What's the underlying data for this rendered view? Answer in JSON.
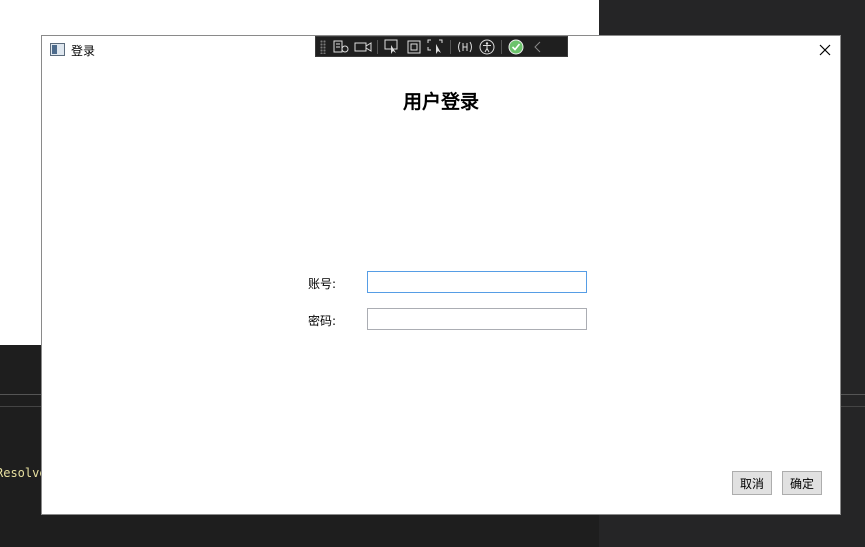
{
  "background": {
    "console_text": "Resolve"
  },
  "window": {
    "title": "登录",
    "heading": "用户登录",
    "fields": {
      "account": {
        "label": "账号:",
        "value": "",
        "placeholder": ""
      },
      "password": {
        "label": "密码:",
        "value": "",
        "placeholder": ""
      }
    },
    "buttons": {
      "cancel": "取消",
      "confirm": "确定"
    }
  },
  "debug_toolbar": {
    "icons": [
      "live-visual-tree-icon",
      "record-icon",
      "select-element-icon",
      "display-adorners-icon",
      "track-focus-icon",
      "binding-failures-icon",
      "accessibility-icon",
      "hot-reload-check-icon",
      "collapse-toolbar-icon"
    ]
  },
  "colors": {
    "console_text": "#e8e0a0",
    "toolbar_bg": "#1f1f1f",
    "focus_border": "#569de5",
    "check_green": "#6cc36c"
  }
}
